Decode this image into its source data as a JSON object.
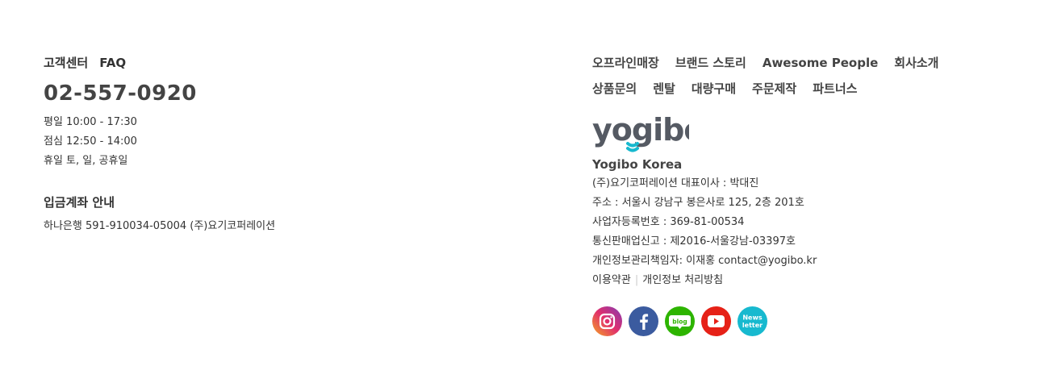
{
  "customer_center": {
    "label": "고객센터",
    "faq": "FAQ",
    "phone": "02-557-0920",
    "hours": [
      "평일 10:00 - 17:30",
      "점심 12:50 - 14:00",
      "휴일 토, 일, 공휴일"
    ]
  },
  "bank": {
    "title": "입금계좌 안내",
    "account": "하나은행 591-910034-05004 (주)요기코퍼레이션"
  },
  "nav": {
    "row1": [
      "오프라인매장",
      "브랜드 스토리",
      "Awesome People",
      "회사소개"
    ],
    "row2": [
      "상품문의",
      "렌탈",
      "대량구매",
      "주문제작",
      "파트너스"
    ]
  },
  "company": {
    "logo_text": "yogibo",
    "name": "Yogibo Korea",
    "lines": [
      "(주)요기코퍼레이션 대표이사 : 박대진",
      "주소 : 서울시 강남구 봉은사로 125, 2층 201호",
      "사업자등록번호 : 369-81-00534",
      "통신판매업신고 : 제2016-서울강남-03397호",
      "개인정보관리책임자: 이재홍 contact@yogibo.kr"
    ],
    "terms": "이용약관",
    "separator": "|",
    "privacy": "개인정보 처리방침"
  },
  "social": {
    "icons": [
      "instagram-icon",
      "facebook-icon",
      "blog-icon",
      "youtube-icon",
      "newsletter-icon"
    ],
    "blog_label": "blog",
    "news_line1": "News",
    "news_line2": "letter"
  },
  "colors": {
    "logo_gray": "#555a63",
    "logo_accent": "#17b9cf",
    "instagram": "#e1306c",
    "facebook": "#3b5b9f",
    "blog": "#2db400",
    "youtube": "#e62117",
    "newsletter": "#17b9cf"
  }
}
